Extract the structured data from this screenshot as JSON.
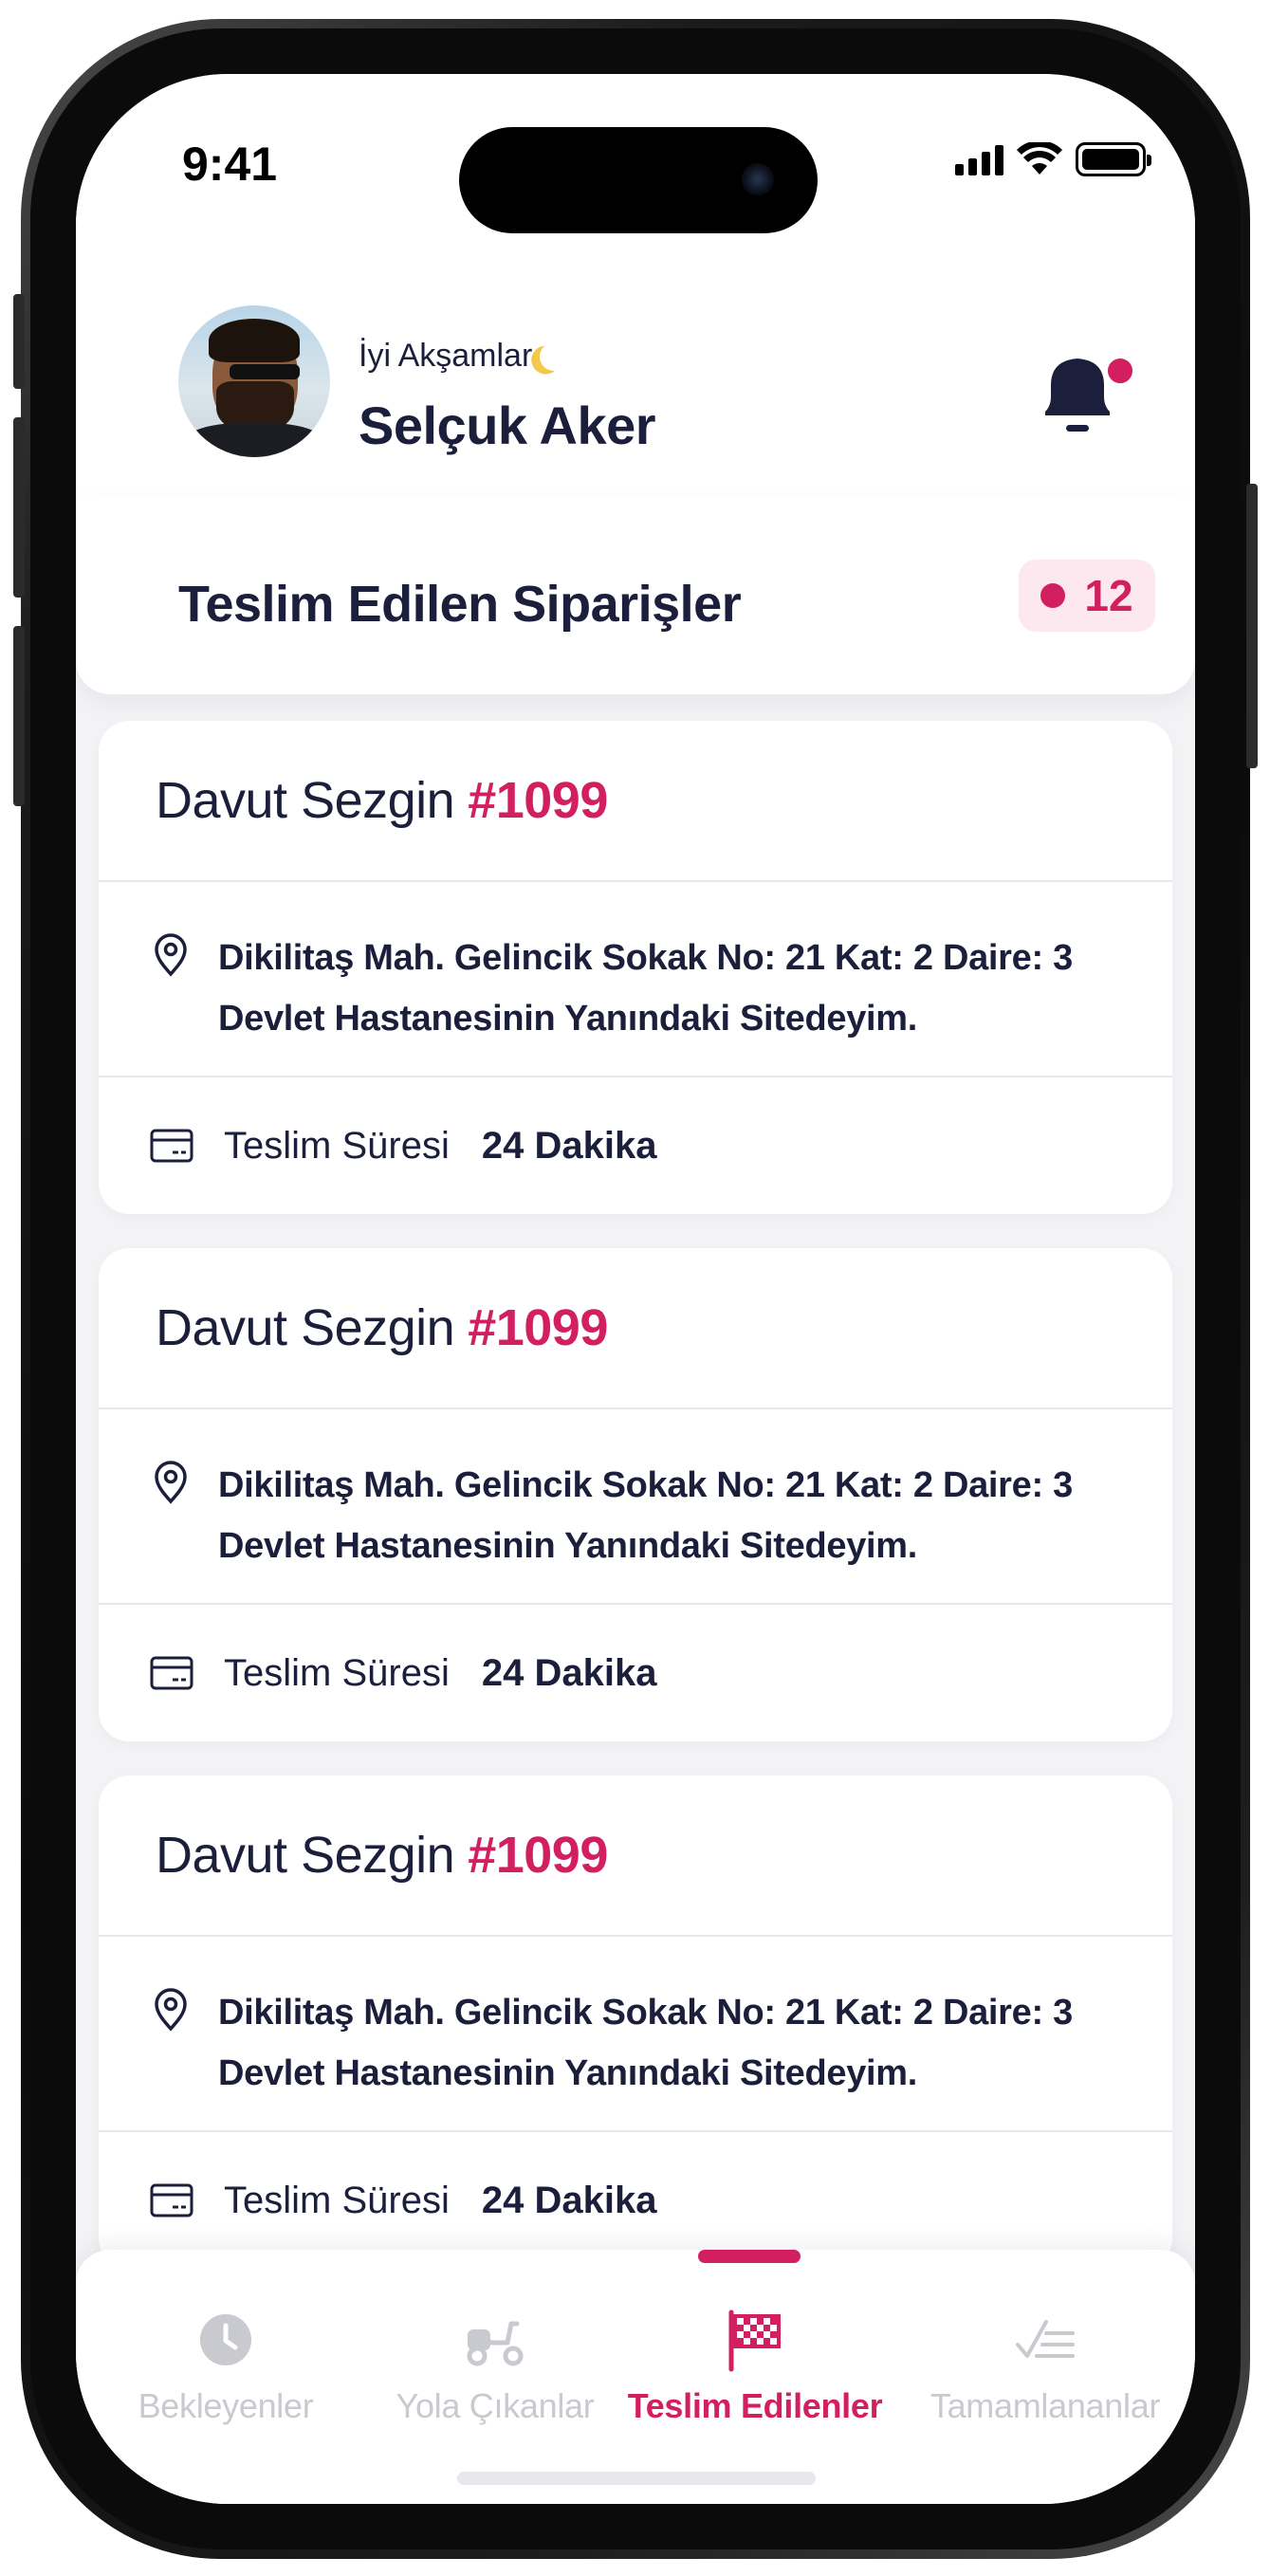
{
  "status_bar": {
    "time": "9:41"
  },
  "header": {
    "greeting": "İyi Akşamlar",
    "greeting_icon": "moon-icon",
    "user_name": "Selçuk Aker",
    "notification_icon": "bell-icon",
    "has_unread_notification": true
  },
  "section": {
    "title": "Teslim Edilen Siparişler",
    "count": "12"
  },
  "orders": [
    {
      "customer": "Davut Sezgin",
      "order_no": "#1099",
      "address_line1": "Dikilitaş Mah. Gelincik Sokak No: 21 Kat: 2 Daire: 3",
      "address_line2": "Devlet Hastanesinin Yanındaki Sitedeyim.",
      "time_label": "Teslim Süresi",
      "time_value": "24 Dakika"
    },
    {
      "customer": "Davut Sezgin",
      "order_no": "#1099",
      "address_line1": "Dikilitaş Mah. Gelincik Sokak No: 21 Kat: 2 Daire: 3",
      "address_line2": "Devlet Hastanesinin Yanındaki Sitedeyim.",
      "time_label": "Teslim Süresi",
      "time_value": "24 Dakika"
    },
    {
      "customer": "Davut Sezgin",
      "order_no": "#1099",
      "address_line1": "Dikilitaş Mah. Gelincik Sokak No: 21 Kat: 2 Daire: 3",
      "address_line2": "Devlet Hastanesinin Yanındaki Sitedeyim.",
      "time_label": "Teslim Süresi",
      "time_value": "24 Dakika"
    }
  ],
  "tabs": [
    {
      "label": "Bekleyenler",
      "icon": "clock-icon",
      "active": false
    },
    {
      "label": "Yola Çıkanlar",
      "icon": "scooter-icon",
      "active": false
    },
    {
      "label": "Teslim Edilenler",
      "icon": "checkered-flag-icon",
      "active": true
    },
    {
      "label": "Tamamlananlar",
      "icon": "checklist-icon",
      "active": false
    }
  ],
  "colors": {
    "accent": "#d21f5f",
    "text": "#1c1f3b",
    "inactive": "#c9c9d0",
    "badge_bg": "#fde8ef",
    "background": "#f3f3f6"
  }
}
